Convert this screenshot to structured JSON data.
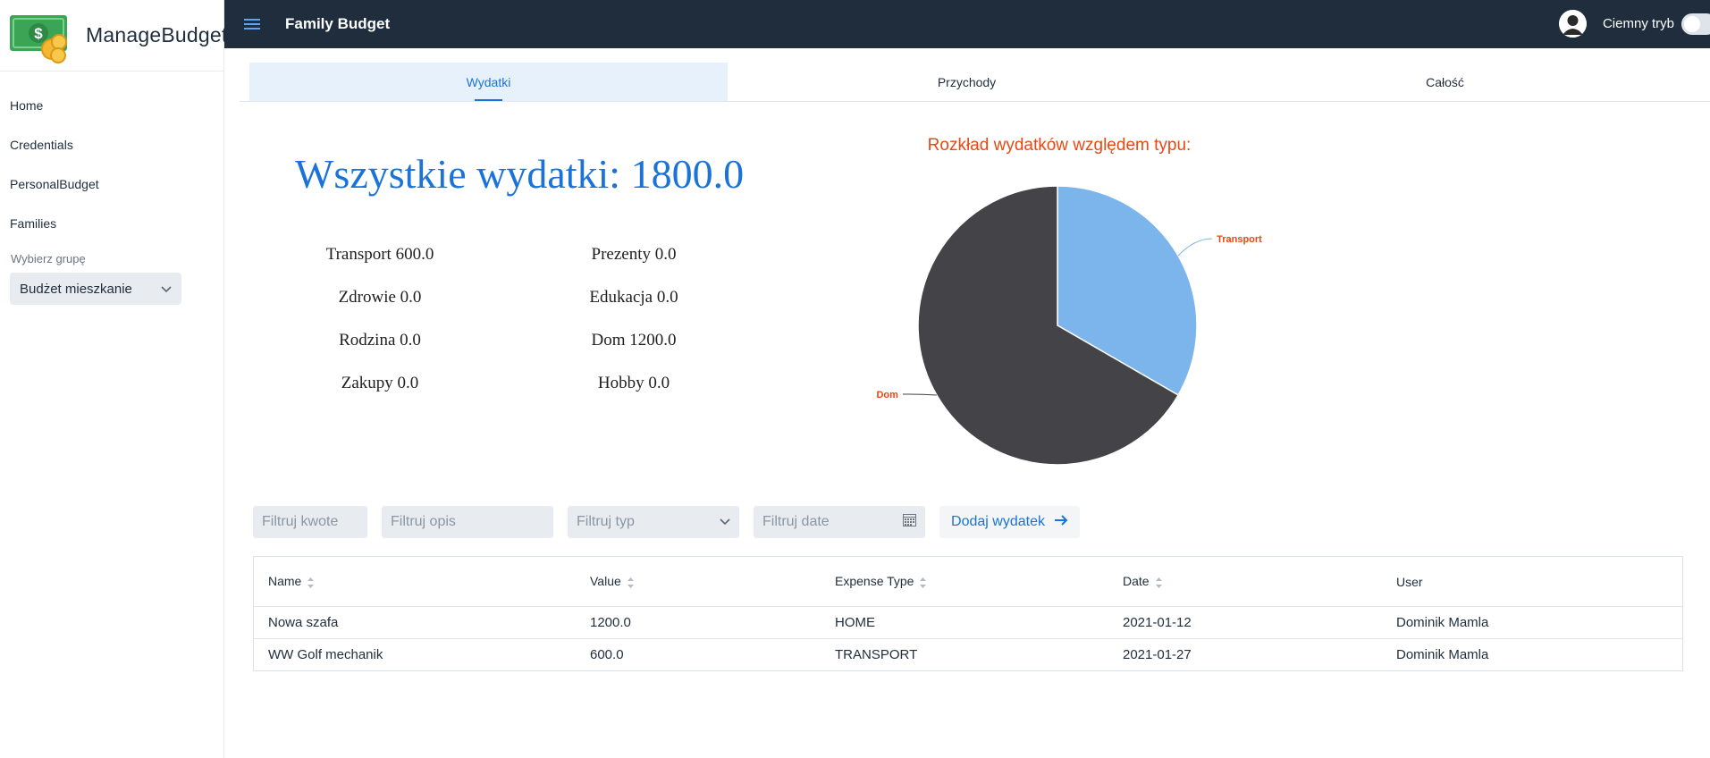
{
  "brand": {
    "name": "ManageBudget",
    "logo_icon": "money-coins-icon"
  },
  "sidebar": {
    "items": [
      {
        "label": "Home"
      },
      {
        "label": "Credentials"
      },
      {
        "label": "PersonalBudget"
      },
      {
        "label": "Families"
      }
    ],
    "group_label": "Wybierz grupę",
    "group_value": "Budżet mieszkanie"
  },
  "topbar": {
    "title": "Family Budget",
    "dark_mode_label": "Ciemny tryb",
    "dark_mode_on": false
  },
  "tabs": [
    {
      "label": "Wydatki",
      "active": true
    },
    {
      "label": "Przychody",
      "active": false
    },
    {
      "label": "Całość",
      "active": false
    }
  ],
  "summary": {
    "total": "Wszystkie wydatki: 1800.0",
    "categories": [
      "Transport 600.0",
      "Prezenty 0.0",
      "Zdrowie 0.0",
      "Edukacja 0.0",
      "Rodzina 0.0",
      "Dom 1200.0",
      "Zakupy 0.0",
      "Hobby 0.0"
    ]
  },
  "chart_data": {
    "type": "pie",
    "title": "Rozkład wydatków względem typu:",
    "categories": [
      "Transport",
      "Dom"
    ],
    "values": [
      600,
      1200
    ],
    "colors": [
      "#7cb5ec",
      "#434348"
    ],
    "label_color": "#ea4811"
  },
  "filters": {
    "amount_placeholder": "Filtruj kwote",
    "description_placeholder": "Filtruj opis",
    "type_placeholder": "Filtruj typ",
    "date_placeholder": "Filtruj date",
    "add_label": "Dodaj wydatek"
  },
  "table": {
    "headers": [
      "Name",
      "Value",
      "Expense Type",
      "Date",
      "User"
    ],
    "rows": [
      [
        "Nowa szafa",
        "1200.0",
        "HOME",
        "2021-01-12",
        "Dominik Mamla"
      ],
      [
        "WW Golf mechanik",
        "600.0",
        "TRANSPORT",
        "2021-01-27",
        "Dominik Mamla"
      ]
    ]
  }
}
